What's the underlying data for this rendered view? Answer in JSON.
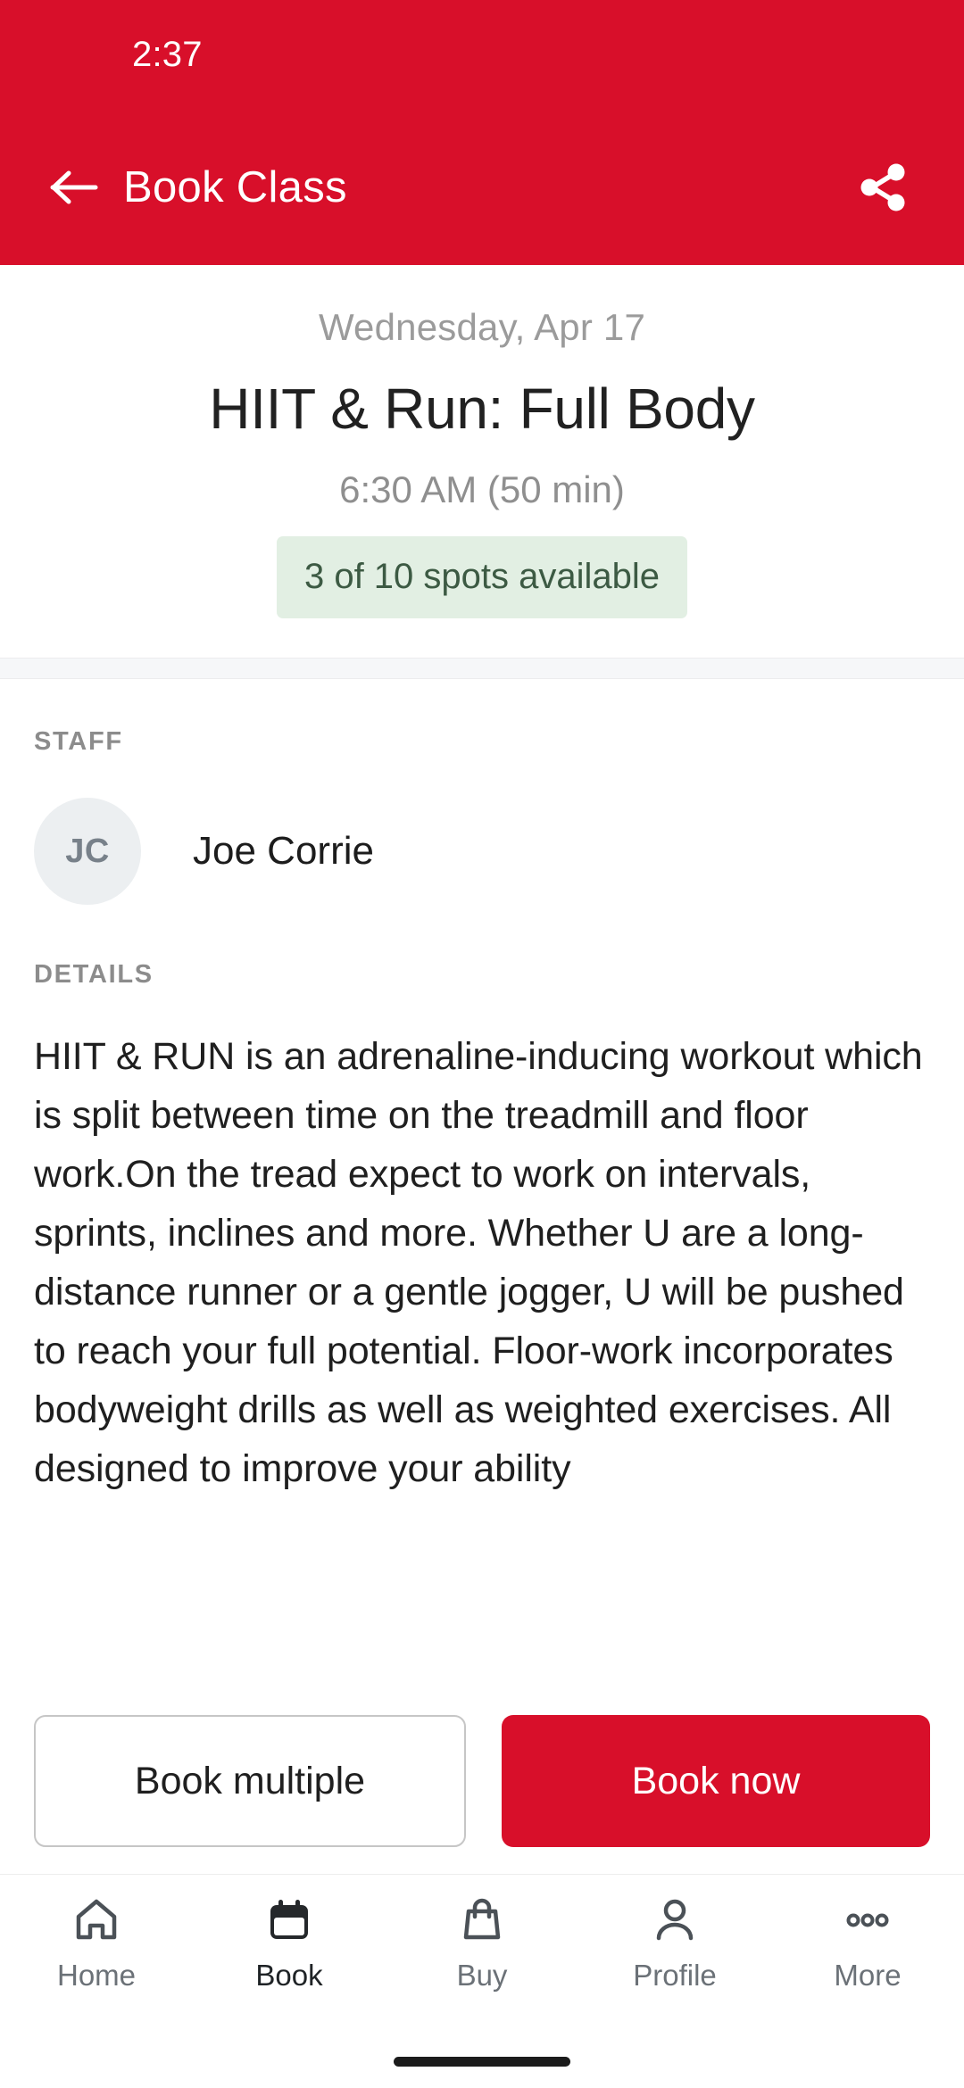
{
  "status_bar": {
    "time": "2:37"
  },
  "app_bar": {
    "title": "Book Class",
    "back_icon": "arrow-left-icon",
    "share_icon": "share-icon",
    "background_color": "#D80F2A",
    "text_color": "#FFFFFF"
  },
  "class_header": {
    "date": "Wednesday, Apr 17",
    "name": "HIIT & Run: Full Body",
    "time": "6:30 AM (50 min)",
    "spots_badge": "3 of 10 spots available",
    "spots_badge_bg": "#E2EFE3",
    "spots_badge_color": "#3C5A43"
  },
  "staff_section": {
    "label": "STAFF",
    "members": [
      {
        "initials": "JC",
        "name": "Joe Corrie"
      }
    ]
  },
  "details_section": {
    "label": "DETAILS",
    "text": "HIIT & RUN is an adrenaline-inducing workout which is split between time on the treadmill and floor work.On the tread expect to work on intervals, sprints, inclines and more. Whether U are a long-distance runner or a gentle jogger, U will be pushed to reach your full potential. Floor-work incorporates bodyweight drills as well as weighted exercises. All designed to improve your ability"
  },
  "actions": {
    "secondary_label": "Book multiple",
    "primary_label": "Book now",
    "primary_bg": "#D80F2A"
  },
  "bottom_nav": {
    "items": [
      {
        "label": "Home",
        "icon": "home-icon",
        "active": false
      },
      {
        "label": "Book",
        "icon": "calendar-icon",
        "active": true
      },
      {
        "label": "Buy",
        "icon": "bag-icon",
        "active": false
      },
      {
        "label": "Profile",
        "icon": "person-icon",
        "active": false
      },
      {
        "label": "More",
        "icon": "ellipsis-icon",
        "active": false
      }
    ]
  }
}
